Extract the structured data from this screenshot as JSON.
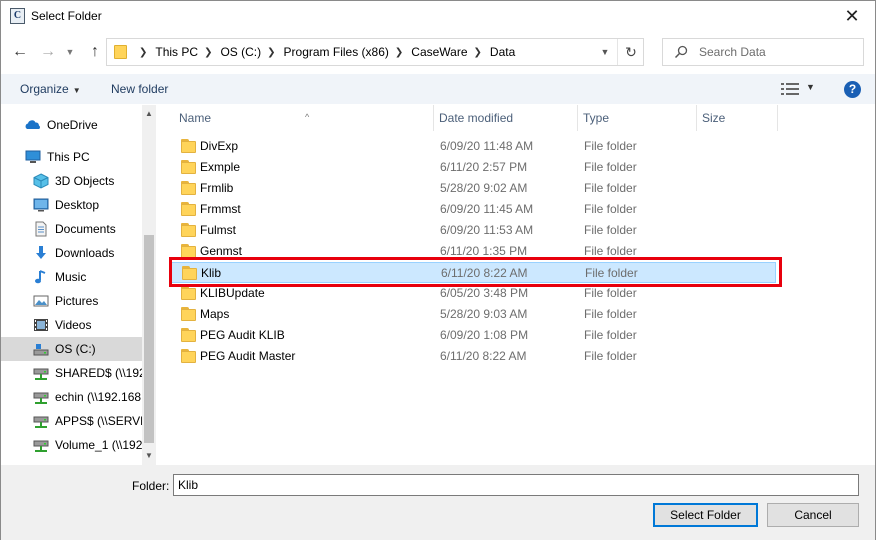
{
  "window": {
    "title": "Select Folder",
    "app_icon_glyph": "C"
  },
  "address": {
    "crumbs": [
      "This PC",
      "OS (C:)",
      "Program Files (x86)",
      "CaseWare",
      "Data"
    ]
  },
  "search": {
    "placeholder": "Search Data"
  },
  "toolbar": {
    "organize_label": "Organize",
    "new_folder_label": "New folder"
  },
  "navigation": {
    "items": [
      {
        "label": "OneDrive",
        "icon": "onedrive-icon"
      },
      {
        "label": "This PC",
        "icon": "computer-icon"
      },
      {
        "label": "3D Objects",
        "icon": "3d-objects-icon"
      },
      {
        "label": "Desktop",
        "icon": "desktop-icon"
      },
      {
        "label": "Documents",
        "icon": "documents-icon"
      },
      {
        "label": "Downloads",
        "icon": "downloads-icon"
      },
      {
        "label": "Music",
        "icon": "music-icon"
      },
      {
        "label": "Pictures",
        "icon": "pictures-icon"
      },
      {
        "label": "Videos",
        "icon": "videos-icon"
      },
      {
        "label": "OS (C:)",
        "icon": "drive-icon",
        "selected": true
      },
      {
        "label": "SHARED$ (\\\\192",
        "icon": "network-drive-icon"
      },
      {
        "label": "echin (\\\\192.168",
        "icon": "network-drive-icon"
      },
      {
        "label": "APPS$ (\\\\SERVEI",
        "icon": "network-drive-icon"
      },
      {
        "label": "Volume_1 (\\\\192",
        "icon": "network-drive-icon"
      }
    ]
  },
  "columns": {
    "name": "Name",
    "date": "Date modified",
    "type": "Type",
    "size": "Size"
  },
  "files": [
    {
      "name": "DivExp",
      "date": "6/09/20 11:48 AM",
      "type": "File folder"
    },
    {
      "name": "Exmple",
      "date": "6/11/20 2:57 PM",
      "type": "File folder"
    },
    {
      "name": "Frmlib",
      "date": "5/28/20 9:02 AM",
      "type": "File folder"
    },
    {
      "name": "Frmmst",
      "date": "6/09/20 11:45 AM",
      "type": "File folder"
    },
    {
      "name": "Fulmst",
      "date": "6/09/20 11:53 AM",
      "type": "File folder"
    },
    {
      "name": "Genmst",
      "date": "6/11/20 1:35 PM",
      "type": "File folder"
    },
    {
      "name": "Klib",
      "date": "6/11/20 8:22 AM",
      "type": "File folder",
      "selected": true
    },
    {
      "name": "KLIBUpdate",
      "date": "6/05/20 3:48 PM",
      "type": "File folder"
    },
    {
      "name": "Maps",
      "date": "5/28/20 9:03 AM",
      "type": "File folder"
    },
    {
      "name": "PEG Audit KLIB",
      "date": "6/09/20 1:08 PM",
      "type": "File folder"
    },
    {
      "name": "PEG Audit Master",
      "date": "6/11/20 8:22 AM",
      "type": "File folder"
    }
  ],
  "footer": {
    "folder_label": "Folder:",
    "folder_value": "Klib",
    "select_button": "Select Folder",
    "cancel_button": "Cancel"
  },
  "colors": {
    "selection": "#cce8ff",
    "highlight_border": "#e8000d",
    "accent": "#0078d7"
  }
}
